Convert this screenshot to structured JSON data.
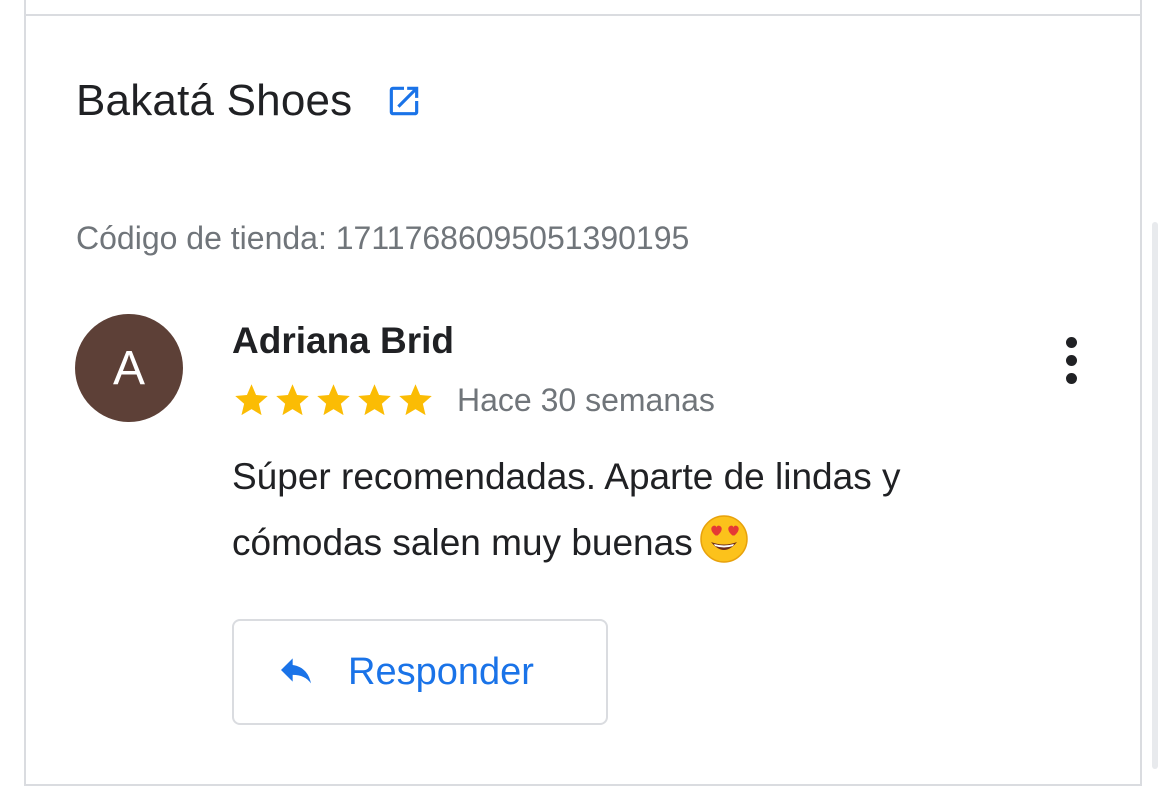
{
  "store": {
    "name": "Bakatá Shoes",
    "code_label": "Código de tienda: 17117686095051390195",
    "open_icon": "open-in-new-icon"
  },
  "review": {
    "avatar_initial": "A",
    "avatar_color": "#5d4037",
    "reviewer_name": "Adriana Brid",
    "rating": 5,
    "rating_max": 5,
    "time_ago": "Hace 30 semanas",
    "text": "Súper recomendadas. Aparte de lindas y cómodas salen muy buenas",
    "emoji": "smiling-face-with-heart-eyes",
    "more_icon": "more-vert-icon"
  },
  "reply": {
    "label": "Responder",
    "icon": "reply-icon"
  },
  "colors": {
    "accent": "#1a73e8",
    "star": "#fbbc04",
    "text_primary": "#202124",
    "text_secondary": "#70757a",
    "border": "#dadce0"
  }
}
